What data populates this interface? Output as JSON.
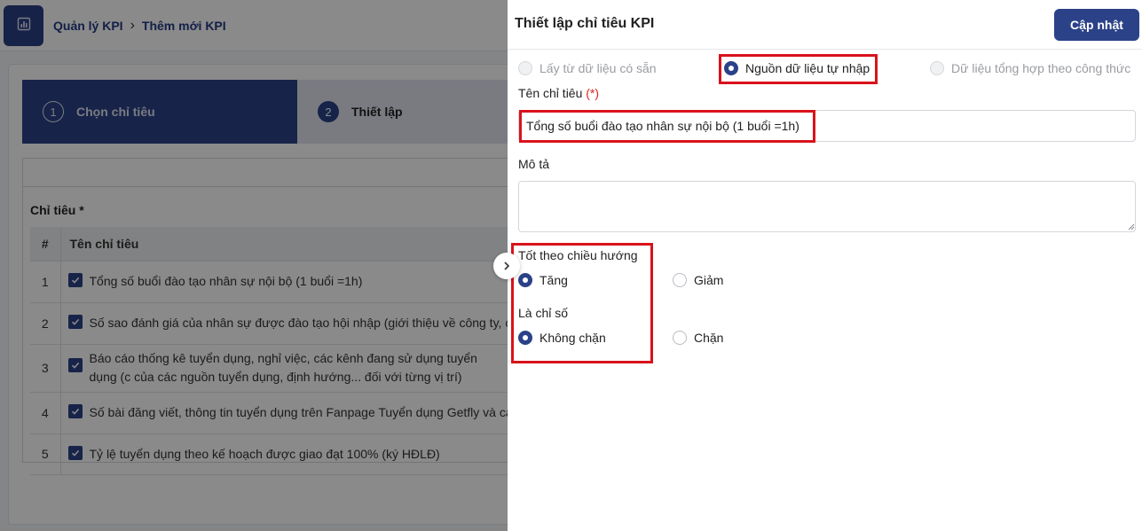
{
  "breadcrumb": {
    "root": "Quản lý KPI",
    "current": "Thêm mới KPI"
  },
  "stepper": [
    {
      "number": "1",
      "label": "Chọn chỉ tiêu"
    },
    {
      "number": "2",
      "label": "Thiết lập"
    }
  ],
  "kpi_list": {
    "section_label": "Chỉ tiêu *",
    "columns": {
      "index": "#",
      "name": "Tên chỉ tiêu"
    },
    "rows": [
      {
        "index": "1",
        "name": "Tổng số buổi đào tạo nhân sự nội bộ (1 buổi =1h)"
      },
      {
        "index": "2",
        "name": "Số sao đánh giá của nhân sự được đào tạo hội nhập (giới thiệu về công ty, ch"
      },
      {
        "index": "3",
        "name": "Báo cáo thống kê tuyển dụng, nghỉ việc, các kênh đang sử dụng tuyển dụng (c của các nguồn tuyển dụng, định hướng... đối với từng vị trí)"
      },
      {
        "index": "4",
        "name": "Số bài đăng viết, thông tin tuyển dụng trên Fanpage Tuyển dụng Getfly và các"
      },
      {
        "index": "5",
        "name": "Tỷ lệ tuyển dụng theo kế hoạch được giao đạt 100% (ký HĐLĐ)"
      }
    ]
  },
  "drawer": {
    "title": "Thiết lập chỉ tiêu KPI",
    "update_label": "Cập nhật",
    "source_options": {
      "existing": "Lấy từ dữ liệu có sẵn",
      "manual": "Nguồn dữ liệu tự nhập",
      "formula": "Dữ liệu tổng hợp theo công thức",
      "selected": "manual"
    },
    "name_label": "Tên chỉ tiêu",
    "required_mark": "(*)",
    "name_value": "Tổng số buổi đào tạo nhân sự nội bộ (1 buổi =1h)",
    "description_label": "Mô tả",
    "description_value": "",
    "direction": {
      "label": "Tốt theo chiều hướng",
      "increase": "Tăng",
      "decrease": "Giảm",
      "selected": "increase"
    },
    "cap": {
      "label": "Là chỉ số",
      "uncapped": "Không chặn",
      "capped": "Chặn",
      "selected": "uncapped"
    }
  },
  "colors": {
    "primary": "#2b4288",
    "highlight": "#d9121b",
    "required": "#d9261c"
  },
  "icons": [
    "chart-icon",
    "chevron-right-icon",
    "check-icon",
    "resize-handle-icon"
  ]
}
